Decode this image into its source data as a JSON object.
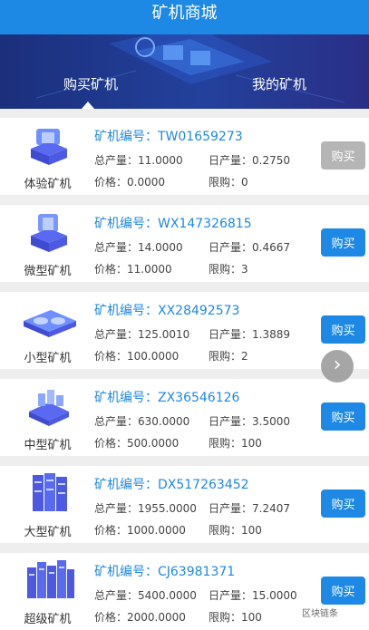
{
  "header": {
    "title": "矿机商城"
  },
  "tabs": [
    {
      "label": "购买矿机",
      "active": true
    },
    {
      "label": "我的矿机",
      "active": false
    }
  ],
  "field_labels": {
    "code": "矿机编号：",
    "total": "总产量：",
    "daily": "日产量：",
    "price": "价格：",
    "limit": "限购："
  },
  "machines": [
    {
      "name": "体验矿机",
      "code": "TW01659273",
      "total": "11.0000",
      "daily": "0.2750",
      "price": "0.0000",
      "limit": "0",
      "button": "购买",
      "button_enabled": false,
      "icon": "single-cube-icon"
    },
    {
      "name": "微型矿机",
      "code": "WX147326815",
      "total": "14.0000",
      "daily": "0.4667",
      "price": "11.0000",
      "limit": "3",
      "button": "购买",
      "button_enabled": true,
      "icon": "single-cube-icon"
    },
    {
      "name": "小型矿机",
      "code": "XX28492573",
      "total": "125.0010",
      "daily": "1.3889",
      "price": "100.0000",
      "limit": "2",
      "button": "购买",
      "button_enabled": true,
      "icon": "fan-board-icon"
    },
    {
      "name": "中型矿机",
      "code": "ZX36546126",
      "total": "630.0000",
      "daily": "3.5000",
      "price": "500.0000",
      "limit": "100",
      "button": "购买",
      "button_enabled": true,
      "icon": "chip-grid-icon"
    },
    {
      "name": "大型矿机",
      "code": "DX517263452",
      "total": "1955.0000",
      "daily": "7.2407",
      "price": "1000.0000",
      "limit": "100",
      "button": "购买",
      "button_enabled": true,
      "icon": "server-rack-icon"
    },
    {
      "name": "超级矿机",
      "code": "CJ63981371",
      "total": "5400.0000",
      "daily": "15.0000",
      "price": "2000.0000",
      "limit": "100",
      "button": "购买",
      "button_enabled": true,
      "icon": "server-cluster-icon"
    }
  ],
  "colors": {
    "primary": "#1e88e5",
    "disabled": "#b5b5b5",
    "banner": "#23419c"
  },
  "watermark": "区块链条"
}
